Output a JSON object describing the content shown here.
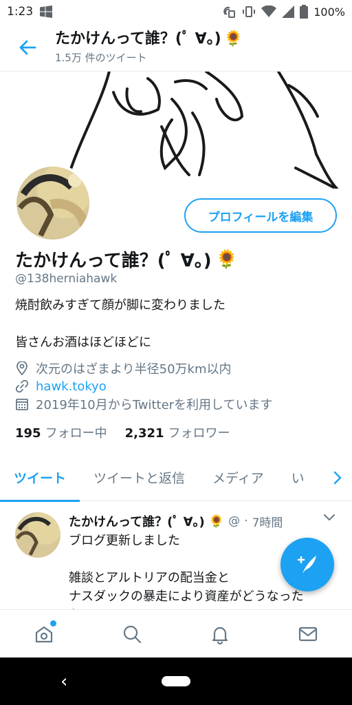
{
  "status_bar": {
    "time": "1:23",
    "battery": "100%"
  },
  "header": {
    "title": "たかけんって誰？(ﾟ ∀。)",
    "title_emoji": "🌻",
    "subtitle": "1.5万 件のツイート"
  },
  "profile": {
    "edit_button": "プロフィールを編集",
    "name": "たかけんって誰？(ﾟ ∀。)",
    "name_emoji": "🌻",
    "handle": "@138herniahawk",
    "bio": [
      "焼酎飲みすぎて顔が脚に変わりました",
      "皆さんお酒はほどほどに"
    ],
    "location": "次元のはざまより半径50万km以内",
    "website": "hawk.tokyo",
    "joined": "2019年10月からTwitterを利用しています",
    "following_count": "195",
    "following_label": "フォロー中",
    "followers_count": "2,321",
    "followers_label": "フォロワー"
  },
  "tabs": [
    "ツイート",
    "ツイートと返信",
    "メディア",
    "い"
  ],
  "tweet": {
    "name": "たかけんって誰？(ﾟ ∀。)",
    "name_emoji": "🌻",
    "handle": "@",
    "dot": "·",
    "time": "7時間",
    "lines": [
      "ブログ更新しました",
      "雑談とアルトリアの配当金と",
      "ナスダックの暴走により資産がどうなった",
      "か"
    ]
  },
  "colors": {
    "accent": "#1da1f2",
    "muted": "#657786",
    "text": "#14171a"
  },
  "icons": [
    "back-arrow-icon",
    "location-pin-icon",
    "link-icon",
    "calendar-icon",
    "home-icon",
    "search-icon",
    "bell-icon",
    "mail-icon",
    "compose-icon",
    "chevron-right-icon",
    "caret-down-icon"
  ]
}
